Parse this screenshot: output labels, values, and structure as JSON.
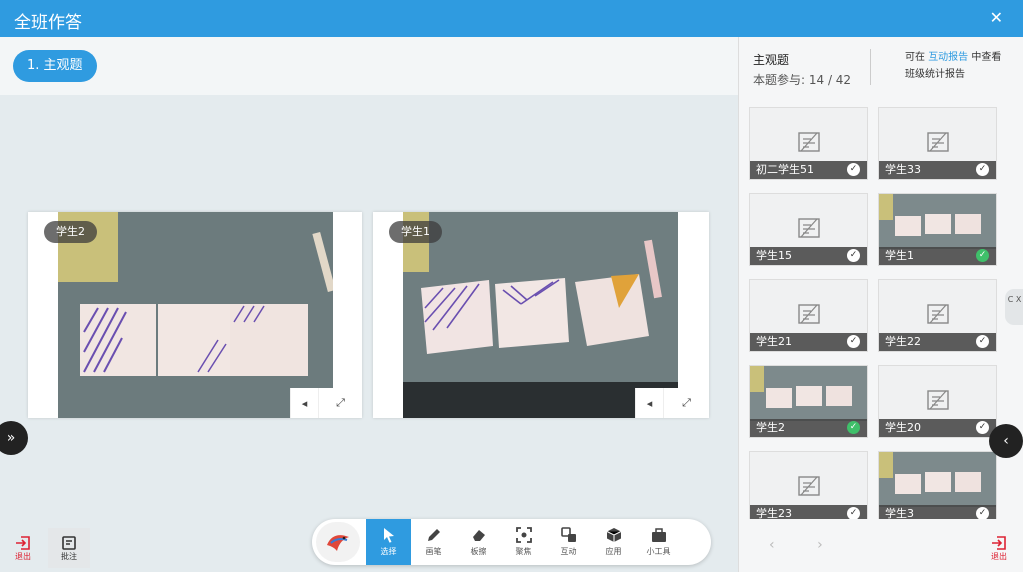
{
  "window": {
    "title": "全班作答"
  },
  "question_tab": {
    "label": "1. 主观题"
  },
  "answers": [
    {
      "student": "学生2"
    },
    {
      "student": "学生1"
    }
  ],
  "right_panel": {
    "title": "主观题",
    "participation": "本题参与: 14 / 42",
    "note_prefix": "可在",
    "note_link": "互动报告",
    "note_suffix": "中查看",
    "note_line2": "班级统计报告",
    "side_tab": "C X",
    "thumbnails": [
      {
        "name": "初二学生51",
        "has_image": false,
        "status": "check"
      },
      {
        "name": "学生33",
        "has_image": false,
        "status": "check"
      },
      {
        "name": "学生15",
        "has_image": false,
        "status": "check"
      },
      {
        "name": "学生1",
        "has_image": true,
        "status": "selected"
      },
      {
        "name": "学生21",
        "has_image": false,
        "status": "check"
      },
      {
        "name": "学生22",
        "has_image": false,
        "status": "check"
      },
      {
        "name": "学生2",
        "has_image": true,
        "status": "selected"
      },
      {
        "name": "学生20",
        "has_image": false,
        "status": "check"
      },
      {
        "name": "学生23",
        "has_image": false,
        "status": "check"
      },
      {
        "name": "学生3",
        "has_image": true,
        "status": "check"
      }
    ]
  },
  "toolbar": {
    "tools": [
      {
        "label": "选择",
        "icon": "cursor-icon",
        "active": true
      },
      {
        "label": "画笔",
        "icon": "pen-icon",
        "active": false
      },
      {
        "label": "板擦",
        "icon": "eraser-icon",
        "active": false
      },
      {
        "label": "聚焦",
        "icon": "focus-icon",
        "active": false
      },
      {
        "label": "互动",
        "icon": "interact-icon",
        "active": false
      },
      {
        "label": "应用",
        "icon": "cube-icon",
        "active": false
      },
      {
        "label": "小工具",
        "icon": "toolbox-icon",
        "active": false
      }
    ]
  },
  "bottom_left": {
    "exit_label": "退出",
    "notes_label": "批注"
  },
  "bottom_right": {
    "exit_label": "退出"
  },
  "colors": {
    "accent": "#2f9be0",
    "selected": "#3fc06a"
  }
}
